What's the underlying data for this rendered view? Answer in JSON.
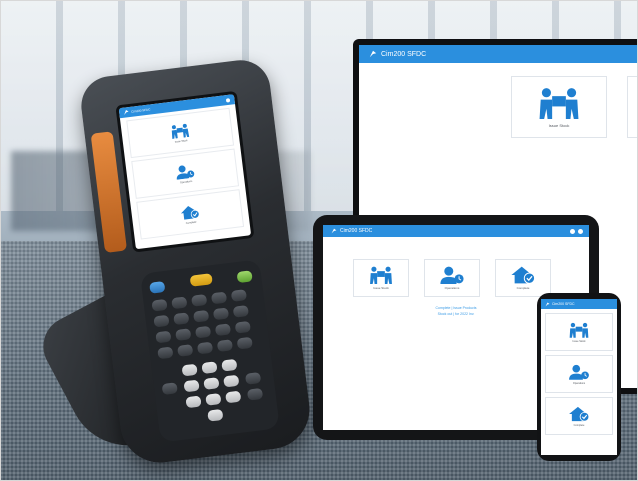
{
  "app": {
    "title": "Cim200 SFDC",
    "tiles": [
      {
        "label": "Issue Stock",
        "icon": "people-carrying-box-icon"
      },
      {
        "label": "Operations",
        "icon": "user-clock-icon"
      },
      {
        "label": "Complete",
        "icon": "house-check-icon"
      }
    ],
    "links": [
      "Complete | Issue Products",
      "Stock out | for 2022 Inv."
    ]
  },
  "colors": {
    "header": "#2b8fde",
    "icon": "#1f7fd0",
    "scanner_accent": "#e88c40",
    "scanner_key_yellow": "#f3c43a"
  }
}
